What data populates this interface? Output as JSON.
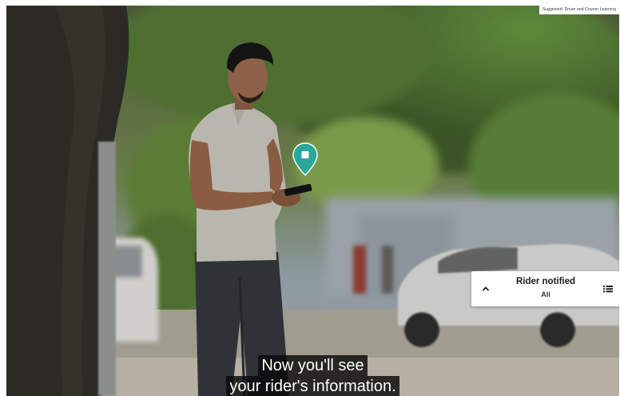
{
  "video": {
    "top_badge": "Suggested: Driver and Courier Learning",
    "pin_icon": "map-pin-icon",
    "card_expand_icon": "chevron-up-icon",
    "card_menu_icon": "list-icon"
  },
  "rider_card": {
    "title": "Rider notified",
    "name": "Ali"
  },
  "captions": {
    "line1": "Now you'll see",
    "line2": "your rider's information."
  },
  "colors": {
    "pin": "#2aa79b",
    "card_bg": "#ffffff",
    "caption_bg": "#080808"
  }
}
